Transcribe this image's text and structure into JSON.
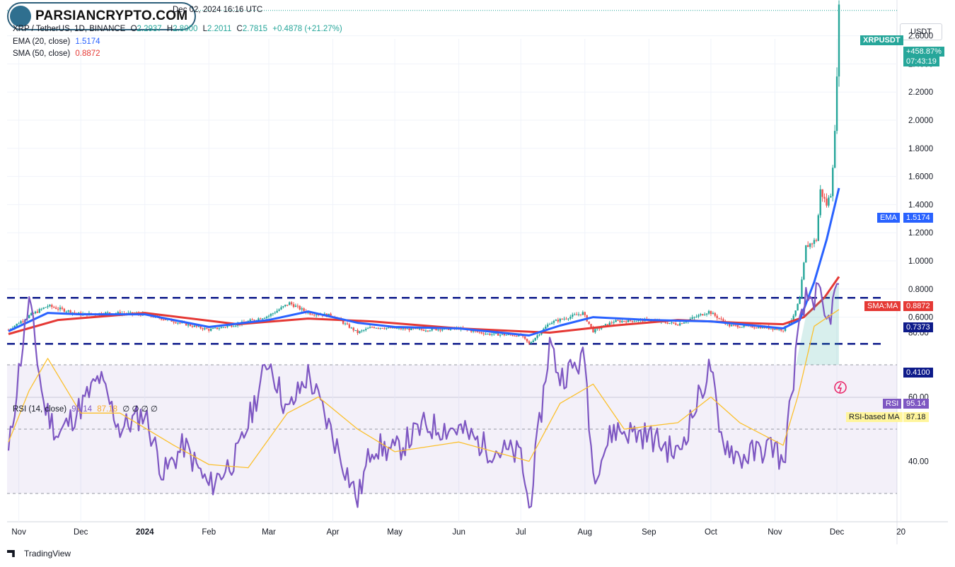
{
  "watermark": {
    "text": "PARSIANCRYPTO.COM"
  },
  "header": {
    "date": "Dec 02, 2024 16:16 UTC",
    "symbol": "XRP / TetherUS, 1D, BINANCE",
    "open_label": "O",
    "open": "2.2937",
    "high_label": "H",
    "high": "2.8000",
    "low_label": "L",
    "low": "2.2011",
    "close_label": "C",
    "close": "2.7815",
    "change": "+0.4878 (+21.27%)",
    "ema_label": "EMA (20, close)",
    "ema_value": "1.5174",
    "sma_label": "SMA (50, close)",
    "sma_value": "0.8872",
    "rsi_label": "RSI (14, close)",
    "rsi_value": "95.14",
    "rsi_ma_value": "87.18",
    "rsi_extra": "∅  ∅  ∅  ∅"
  },
  "currency": "USDT",
  "brand": "TradingView",
  "colors": {
    "up": "#26a69a",
    "down": "#ef5350",
    "ema": "#2962ff",
    "sma": "#e53935",
    "rsi": "#7e57c2",
    "rsi_ma": "#fbc02d",
    "level": "#0d1a8a"
  },
  "chart_data": [
    {
      "type": "line",
      "title": "XRP / TetherUS, 1D, BINANCE",
      "x_ticks": [
        "Nov",
        "Dec",
        "2024",
        "Feb",
        "Mar",
        "Apr",
        "May",
        "Jun",
        "Jul",
        "Aug",
        "Sep",
        "Oct",
        "Nov",
        "Dec",
        "20"
      ],
      "y_ticks": [
        "0.6000",
        "0.8000",
        "1.0000",
        "1.2000",
        "1.4000",
        "1.6000",
        "1.8000",
        "2.0000",
        "2.2000",
        "2.4000",
        "2.6000"
      ],
      "ylim": [
        0.35,
        2.85
      ],
      "levels": [
        0.7373,
        0.41
      ],
      "price_tags": {
        "symbol": "XRPUSDT",
        "change_pct": "+458.87%",
        "countdown": "07:43:19",
        "ema_tag": "EMA",
        "ema": "1.5174",
        "sma_tag": "SMA:MA",
        "sma": "0.8872",
        "level_upper": "0.7373",
        "level_lower": "0.4100"
      },
      "series": [
        {
          "name": "Close",
          "x": [
            "2023-10-27",
            "2023-11-06",
            "2023-11-15",
            "2023-12-01",
            "2023-12-15",
            "2024-01-01",
            "2024-01-15",
            "2024-02-01",
            "2024-02-15",
            "2024-03-01",
            "2024-03-11",
            "2024-03-20",
            "2024-04-01",
            "2024-04-13",
            "2024-04-20",
            "2024-05-01",
            "2024-05-15",
            "2024-06-01",
            "2024-06-15",
            "2024-07-01",
            "2024-07-05",
            "2024-07-15",
            "2024-07-31",
            "2024-08-05",
            "2024-08-15",
            "2024-09-01",
            "2024-09-15",
            "2024-09-30",
            "2024-10-10",
            "2024-10-25",
            "2024-11-05",
            "2024-11-10",
            "2024-11-13",
            "2024-11-16",
            "2024-11-21",
            "2024-11-23",
            "2024-11-26",
            "2024-11-28",
            "2024-11-30",
            "2024-12-01",
            "2024-12-02"
          ],
          "values": [
            0.51,
            0.61,
            0.68,
            0.62,
            0.63,
            0.62,
            0.57,
            0.51,
            0.55,
            0.61,
            0.7,
            0.63,
            0.61,
            0.49,
            0.53,
            0.52,
            0.51,
            0.52,
            0.48,
            0.47,
            0.41,
            0.56,
            0.63,
            0.5,
            0.57,
            0.58,
            0.55,
            0.64,
            0.54,
            0.53,
            0.51,
            0.6,
            0.73,
            1.1,
            1.15,
            1.5,
            1.4,
            1.48,
            1.9,
            2.35,
            2.78
          ]
        },
        {
          "name": "EMA (20, close)",
          "x": [
            "2023-10-27",
            "2023-11-15",
            "2023-12-01",
            "2024-01-01",
            "2024-02-01",
            "2024-03-01",
            "2024-03-20",
            "2024-04-13",
            "2024-05-01",
            "2024-06-01",
            "2024-07-05",
            "2024-07-20",
            "2024-08-05",
            "2024-09-01",
            "2024-10-01",
            "2024-11-05",
            "2024-11-13",
            "2024-11-20",
            "2024-11-26",
            "2024-12-02"
          ],
          "values": [
            0.5,
            0.63,
            0.62,
            0.62,
            0.53,
            0.58,
            0.64,
            0.56,
            0.53,
            0.52,
            0.47,
            0.54,
            0.6,
            0.58,
            0.57,
            0.52,
            0.58,
            0.85,
            1.15,
            1.5174
          ]
        },
        {
          "name": "SMA (50, close)",
          "x": [
            "2023-10-27",
            "2023-11-20",
            "2024-01-01",
            "2024-02-15",
            "2024-03-20",
            "2024-04-20",
            "2024-06-01",
            "2024-07-15",
            "2024-08-15",
            "2024-09-15",
            "2024-10-15",
            "2024-11-05",
            "2024-11-15",
            "2024-11-25",
            "2024-12-02"
          ],
          "values": [
            0.48,
            0.58,
            0.63,
            0.55,
            0.59,
            0.57,
            0.52,
            0.49,
            0.54,
            0.58,
            0.56,
            0.55,
            0.6,
            0.74,
            0.8872
          ]
        }
      ]
    },
    {
      "type": "line",
      "title": "RSI (14, close)",
      "y_ticks": [
        "40.00",
        "60.00",
        "80.00"
      ],
      "ylim": [
        22,
        102
      ],
      "bands": [
        30,
        50,
        70
      ],
      "tags": {
        "rsi_tag": "RSI",
        "rsi": "95.14",
        "ma_tag": "RSI-based MA",
        "ma": "87.18"
      },
      "series": [
        {
          "name": "RSI (14, close)",
          "x": [
            "2023-10-27",
            "2023-11-01",
            "2023-11-06",
            "2023-11-13",
            "2023-11-20",
            "2023-12-01",
            "2023-12-10",
            "2023-12-20",
            "2024-01-01",
            "2024-01-10",
            "2024-01-20",
            "2024-02-01",
            "2024-02-15",
            "2024-03-01",
            "2024-03-10",
            "2024-03-20",
            "2024-04-01",
            "2024-04-13",
            "2024-04-20",
            "2024-05-01",
            "2024-05-15",
            "2024-06-01",
            "2024-06-15",
            "2024-07-01",
            "2024-07-05",
            "2024-07-15",
            "2024-07-20",
            "2024-08-01",
            "2024-08-05",
            "2024-08-15",
            "2024-09-01",
            "2024-09-15",
            "2024-10-01",
            "2024-10-05",
            "2024-10-15",
            "2024-11-01",
            "2024-11-05",
            "2024-11-12",
            "2024-11-16",
            "2024-11-22",
            "2024-11-26",
            "2024-12-02"
          ],
          "values": [
            42,
            68,
            90,
            58,
            48,
            57,
            66,
            50,
            55,
            36,
            45,
            32,
            42,
            72,
            55,
            67,
            48,
            28,
            45,
            43,
            51,
            50,
            44,
            42,
            25,
            77,
            66,
            72,
            36,
            50,
            48,
            42,
            70,
            48,
            41,
            45,
            38,
            78,
            90,
            92,
            82,
            95.14
          ]
        },
        {
          "name": "RSI-based MA",
          "x": [
            "2023-10-27",
            "2023-11-06",
            "2023-11-15",
            "2023-12-01",
            "2023-12-20",
            "2024-01-15",
            "2024-02-01",
            "2024-02-20",
            "2024-03-10",
            "2024-03-25",
            "2024-04-13",
            "2024-05-01",
            "2024-06-01",
            "2024-07-05",
            "2024-07-20",
            "2024-08-05",
            "2024-08-20",
            "2024-09-15",
            "2024-10-01",
            "2024-10-15",
            "2024-11-05",
            "2024-11-12",
            "2024-11-20",
            "2024-12-02"
          ],
          "values": [
            46,
            62,
            72,
            55,
            55,
            45,
            39,
            38,
            55,
            60,
            50,
            43,
            46,
            40,
            58,
            64,
            50,
            52,
            60,
            52,
            45,
            60,
            82,
            87.18
          ]
        }
      ]
    }
  ]
}
